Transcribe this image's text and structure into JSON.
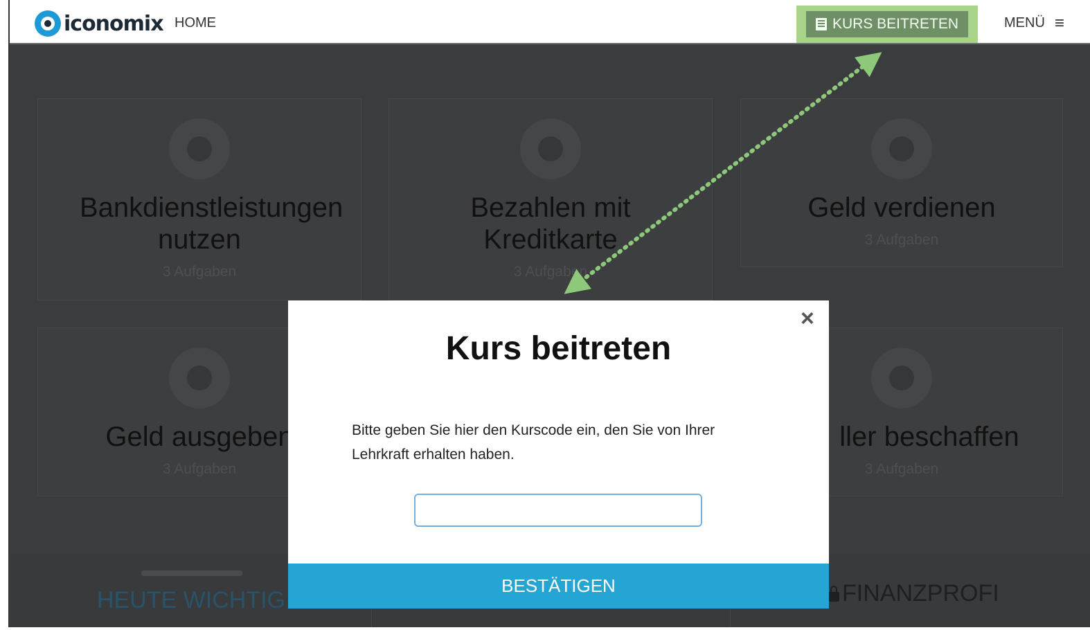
{
  "header": {
    "logo_text": "iconomix",
    "nav_home": "HOME",
    "join_button": "KURS BEITRETEN",
    "menu_label": "MENÜ",
    "menu_icon": "≡"
  },
  "cards": [
    {
      "title": "Bankdienstleistungen nutzen",
      "subtitle": "3 Aufgaben"
    },
    {
      "title": "Bezahlen mit Kreditkarte",
      "subtitle": "3 Aufgaben"
    },
    {
      "title": "Geld verdienen",
      "subtitle": "3 Aufgaben"
    },
    {
      "title": "Geld ausgeben",
      "subtitle": "3 Aufgaben"
    },
    {
      "title": "ller beschaffen",
      "subtitle": "3 Aufgaben"
    }
  ],
  "lower": {
    "left_text": "HEUTE WICHTIG",
    "right_text": "FINANZPROFI"
  },
  "modal": {
    "close_icon": "×",
    "title": "Kurs beitreten",
    "text": "Bitte geben Sie hier den Kurscode ein, den Sie von Ihrer Lehrkraft erhalten haben.",
    "input_value": "",
    "confirm_label": "BESTÄTIGEN"
  },
  "colors": {
    "accent": "#25a5d4",
    "highlight": "#a8d48a",
    "join_button_bg": "#6f8f66",
    "overlay": "#3b3c3e",
    "brand_blue": "#1c9ad6"
  }
}
